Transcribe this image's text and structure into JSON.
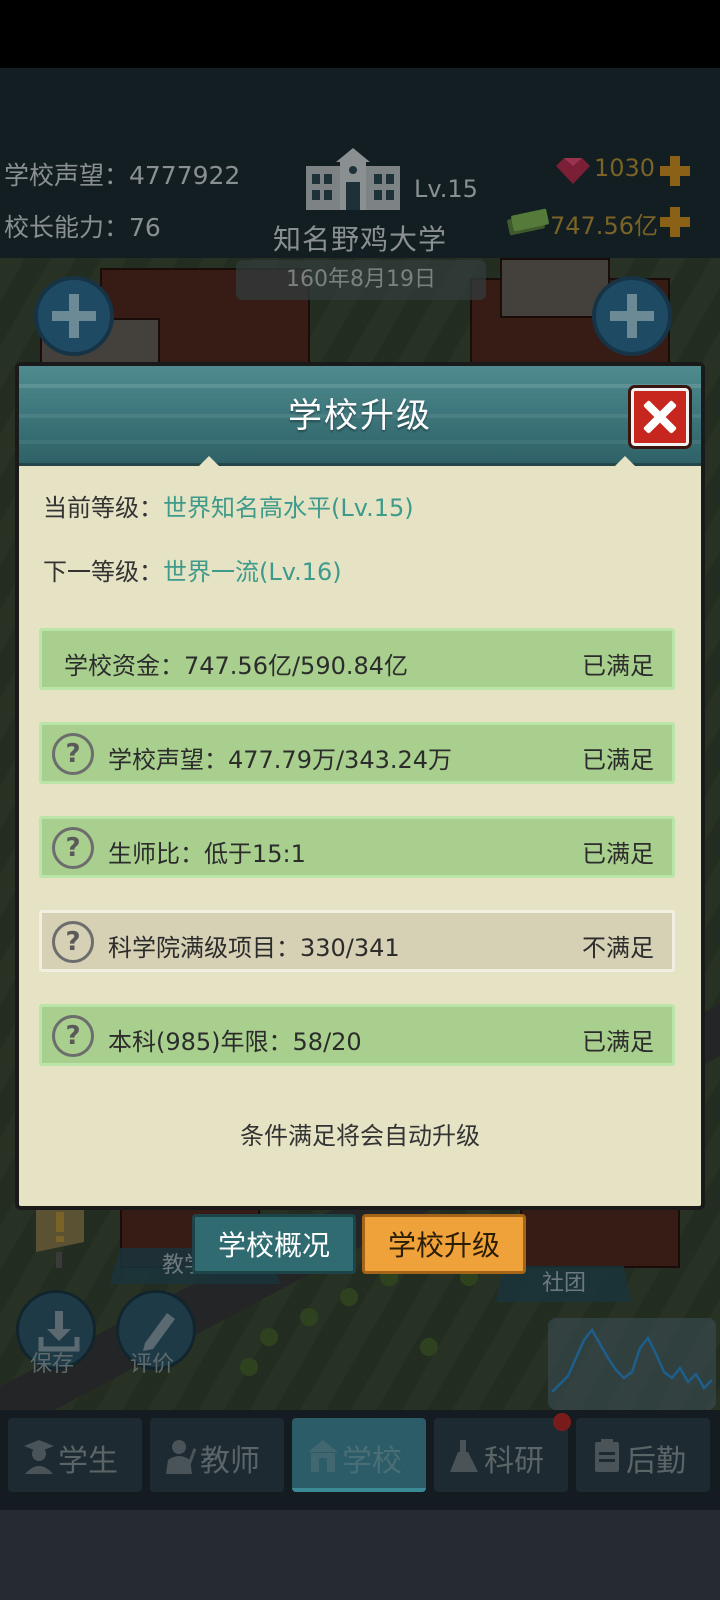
{
  "header": {
    "reputation_label": "学校声望：4777922",
    "ability_label": "校长能力：76",
    "level": "Lv.15",
    "university_name": "知名野鸡大学",
    "date": "160年8月19日",
    "gems": "1030",
    "money": "747.56亿"
  },
  "modal": {
    "title": "学校升级",
    "current_level_label": "当前等级：",
    "current_level_value": "世界知名高水平(Lv.15)",
    "next_level_label": "下一等级：",
    "next_level_value": "世界一流(Lv.16)",
    "requirements": [
      {
        "text": "学校资金：747.56亿/590.84亿",
        "status": "已满足",
        "has_help": false,
        "met": true
      },
      {
        "text": "学校声望：477.79万/343.24万",
        "status": "已满足",
        "has_help": true,
        "met": true
      },
      {
        "text": "生师比：低于15:1",
        "status": "已满足",
        "has_help": true,
        "met": true
      },
      {
        "text": "科学院满级项目：330/341",
        "status": "不满足",
        "has_help": true,
        "met": false
      },
      {
        "text": "本科(985)年限：58/20",
        "status": "已满足",
        "has_help": true,
        "met": true
      }
    ],
    "help_glyph": "?",
    "auto_note": "条件满足将会自动升级"
  },
  "tabs": {
    "overview": "学校概况",
    "upgrade": "学校升级"
  },
  "map": {
    "teaching_building": "教学楼",
    "club": "社团",
    "save": "保存",
    "review": "评价"
  },
  "nav": [
    {
      "label": "学生",
      "icon": "student-icon",
      "active": false
    },
    {
      "label": "教师",
      "icon": "teacher-icon",
      "active": false
    },
    {
      "label": "学校",
      "icon": "school-icon",
      "active": true
    },
    {
      "label": "科研",
      "icon": "research-flask-icon",
      "active": false
    },
    {
      "label": "后勤",
      "icon": "logistics-clipboard-icon",
      "active": false
    }
  ],
  "colors": {
    "met_bg": "#a8cf8d",
    "unmet_bg": "#d6d0b4",
    "level_value": "#3e9a8a",
    "header_teal": "#3b7479",
    "close_red": "#c7261f",
    "upgrade_tab": "#f0a23a"
  }
}
